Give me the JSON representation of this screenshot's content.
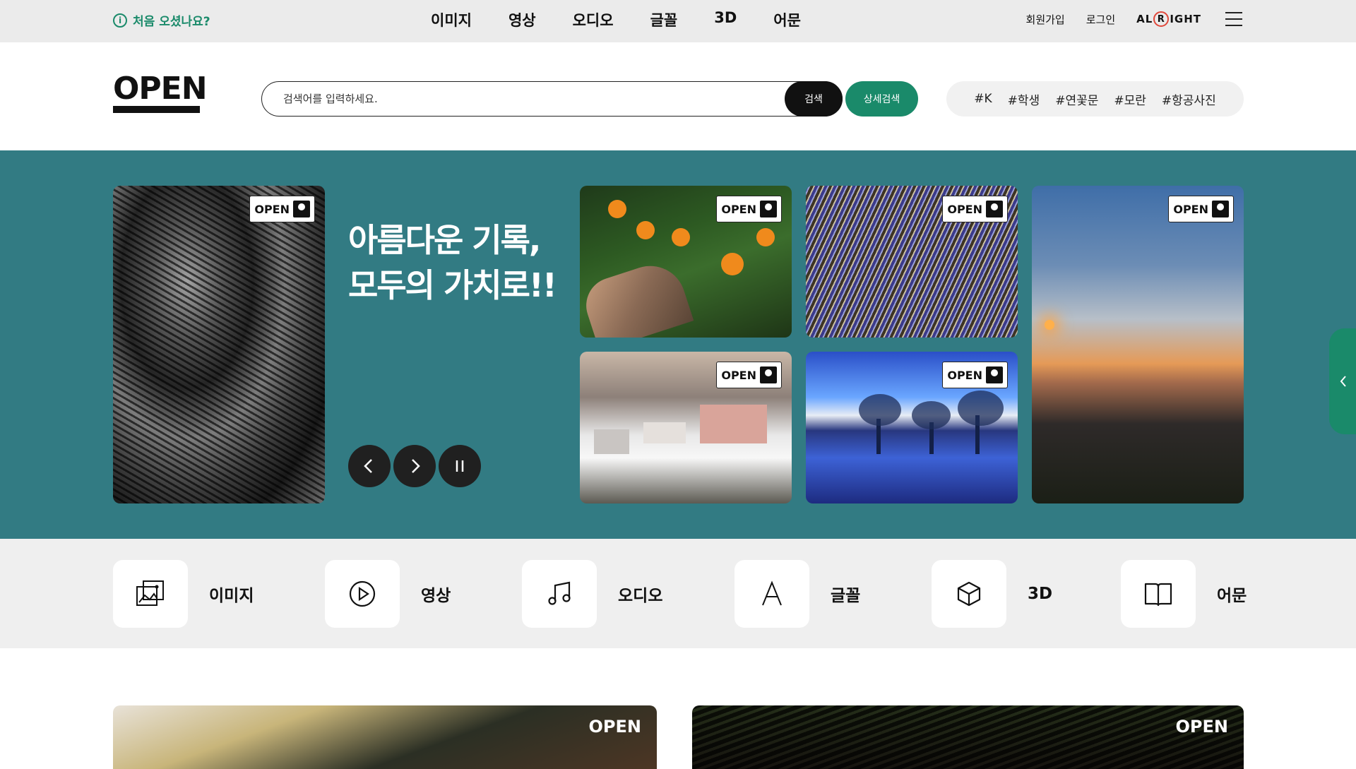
{
  "topbar": {
    "first_visit": "처음 오셨나요?",
    "nav": [
      "이미지",
      "영상",
      "오디오",
      "글꼴",
      "3D",
      "어문"
    ],
    "signup": "회원가입",
    "login": "로그인",
    "alright": {
      "pre": "AL",
      "r": "R",
      "post": "IGHT"
    }
  },
  "header": {
    "logo": "OPEN",
    "search_placeholder": "검색어를 입력하세요.",
    "search_button": "검색",
    "advanced_search_button": "상세검색",
    "tags": [
      "#K",
      "#학생",
      "#연꽃문",
      "#모란",
      "#항공사진"
    ]
  },
  "hero": {
    "title_line1": "아름다운 기록,",
    "title_line2": "모두의 가치로!!",
    "badge": "OPEN"
  },
  "categories": [
    {
      "label": "이미지",
      "icon": "image-icon"
    },
    {
      "label": "영상",
      "icon": "play-icon"
    },
    {
      "label": "오디오",
      "icon": "music-note-icon"
    },
    {
      "label": "글꼴",
      "icon": "font-icon"
    },
    {
      "label": "3D",
      "icon": "cube-icon"
    },
    {
      "label": "어문",
      "icon": "book-icon"
    }
  ],
  "thumbnails": {
    "badge": "OPEN"
  },
  "colors": {
    "brand_green": "#1a8a6a",
    "hero_teal": "#327b83",
    "alright_red": "#e0483b"
  }
}
